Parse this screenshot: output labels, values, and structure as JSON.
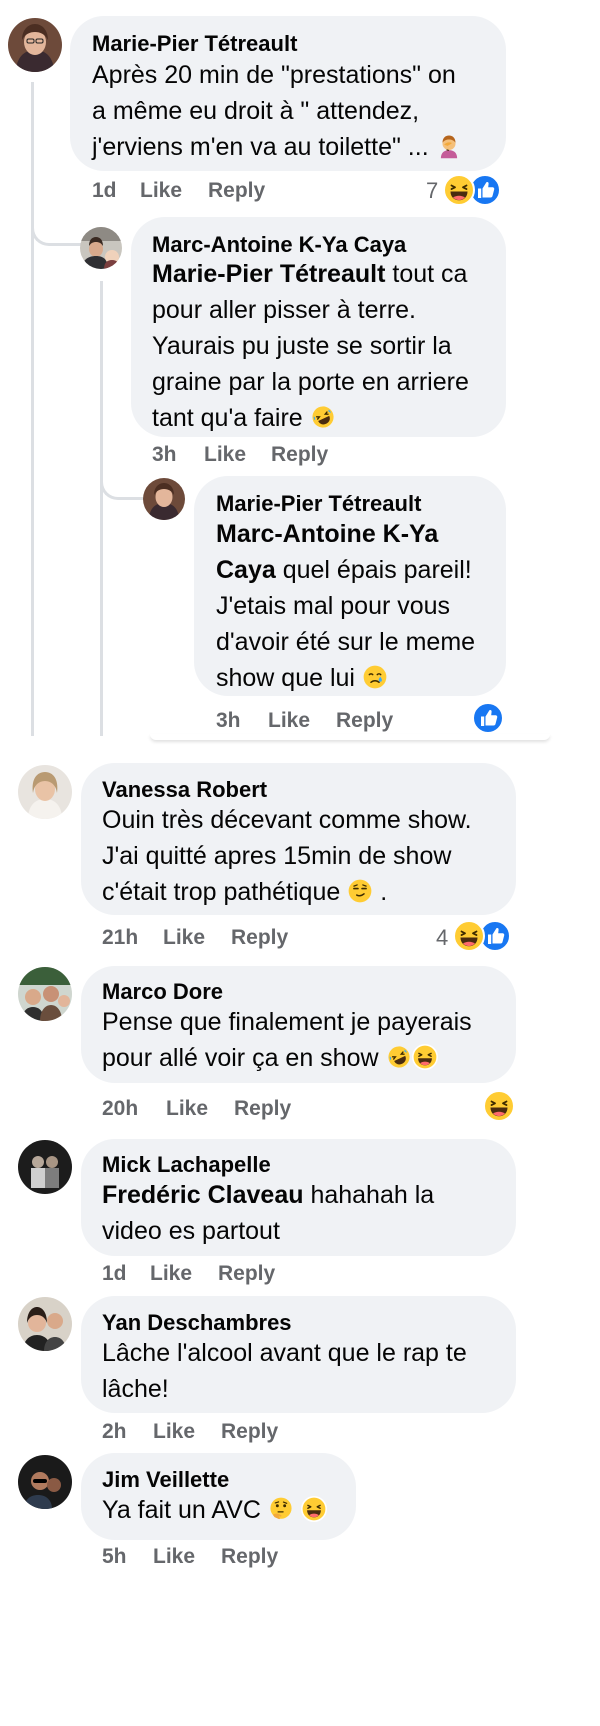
{
  "comments": [
    {
      "author": "Marie-Pier Tétreault",
      "lines": [
        "Après 20 min de \"prestations\" on",
        "a même eu droit à \" attendez,",
        "j'erviens m'en va au toilette\" ..."
      ],
      "time": "1d",
      "like": "Like",
      "reply": "Reply",
      "reaction_count": "7",
      "emojis": [
        "person-facepalming-emoji"
      ]
    },
    {
      "author": "Marc-Antoine K-Ya Caya",
      "mention": "Marie-Pier Tétreault",
      "lines": [
        " tout ca",
        "pour aller pisser à terre.",
        "Yaurais pu juste se sortir la",
        "graine par la porte en arriere",
        "tant qu'a faire"
      ],
      "time": "3h",
      "like": "Like",
      "reply": "Reply"
    },
    {
      "author": "Marie-Pier Tétreault",
      "mention_lines": [
        "Marc-Antoine K-Ya",
        "Caya"
      ],
      "lines": [
        " quel épais pareil!",
        "J'etais mal pour vous",
        "d'avoir été sur le meme",
        "show que lui"
      ],
      "time": "3h",
      "like": "Like",
      "reply": "Reply"
    },
    {
      "author": "Vanessa Robert",
      "lines": [
        "Ouin très décevant comme show.",
        "J'ai quitté apres 15min de show",
        "c'était trop pathétique",
        "."
      ],
      "time": "21h",
      "like": "Like",
      "reply": "Reply",
      "reaction_count": "4"
    },
    {
      "author": "Marco Dore",
      "lines": [
        "Pense que finalement je payerais",
        "pour allé voir ça en show"
      ],
      "time": "20h",
      "like": "Like",
      "reply": "Reply"
    },
    {
      "author": "Mick Lachapelle",
      "mention": "Fredéric Claveau",
      "lines": [
        " hahahah la",
        "video es partout"
      ],
      "time": "1d",
      "like": "Like",
      "reply": "Reply"
    },
    {
      "author": "Yan Deschambres",
      "lines": [
        "Lâche l'alcool avant que le rap te",
        "lâche!"
      ],
      "time": "2h",
      "like": "Like",
      "reply": "Reply"
    },
    {
      "author": "Jim Veillette",
      "lines": [
        "Ya fait un AVC"
      ],
      "time": "5h",
      "like": "Like",
      "reply": "Reply"
    }
  ],
  "colors": {
    "bubble": "#f0f2f5",
    "text": "#050505",
    "meta": "#65676b",
    "like_blue": "#1877f2",
    "emoji_yellow": "#ffcc33",
    "thread_line": "#dcdfe3"
  },
  "icons": [
    "like-reaction-icon",
    "haha-reaction-icon",
    "rofl-emoji",
    "thinking-emoji",
    "smirk-emoji",
    "sad-emoji",
    "person-facepalming-emoji"
  ]
}
